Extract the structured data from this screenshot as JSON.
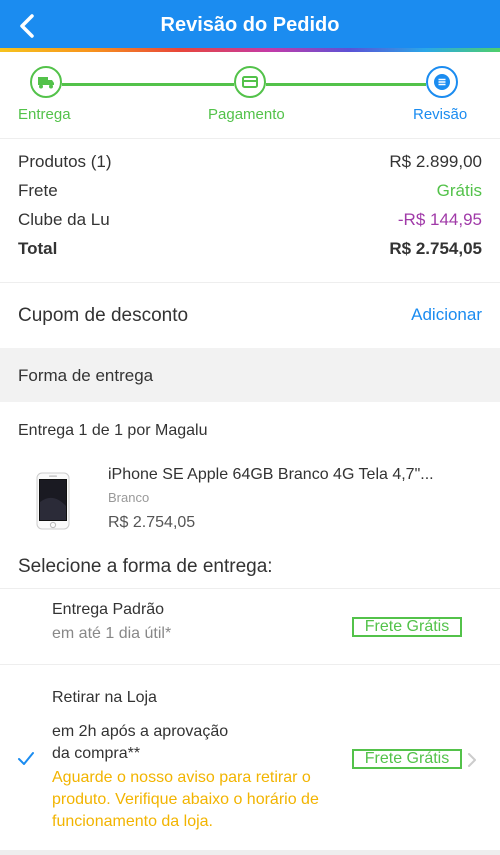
{
  "header": {
    "title": "Revisão do Pedido"
  },
  "steps": [
    {
      "label": "Entrega",
      "icon": "truck-icon"
    },
    {
      "label": "Pagamento",
      "icon": "card-icon"
    },
    {
      "label": "Revisão",
      "icon": "list-icon"
    }
  ],
  "colors": {
    "blue": "#1b8cf0",
    "green": "#53c24a",
    "purple": "#a03aa8",
    "yellow": "#f2b400"
  },
  "summary": {
    "produtos_label": "Produtos (1)",
    "produtos_value": "R$ 2.899,00",
    "frete_label": "Frete",
    "frete_value": "Grátis",
    "clube_label": "Clube da Lu",
    "clube_value": "-R$ 144,95",
    "total_label": "Total",
    "total_value": "R$ 2.754,05"
  },
  "coupon": {
    "label": "Cupom de desconto",
    "action": "Adicionar"
  },
  "delivery_section": {
    "title": "Forma de entrega"
  },
  "entrega": {
    "count": "Entrega 1 de 1",
    "by": "por Magalu"
  },
  "product": {
    "name": "iPhone SE Apple 64GB Branco 4G Tela 4,7\"...",
    "color": "Branco",
    "price": "R$ 2.754,05"
  },
  "select_title": "Selecione a forma de entrega:",
  "options": [
    {
      "title": "Entrega Padrão",
      "subtitle": "em até 1 dia útil*",
      "badge": "Frete Grátis"
    },
    {
      "title": "Retirar na Loja",
      "subtitle_line1": "em 2h após a aprovação",
      "subtitle_line2": "da compra**",
      "badge": "Frete Grátis",
      "note": "Aguarde o nosso aviso para retirar o produto. Verifique abaixo o horário de funcionamento da loja."
    }
  ]
}
